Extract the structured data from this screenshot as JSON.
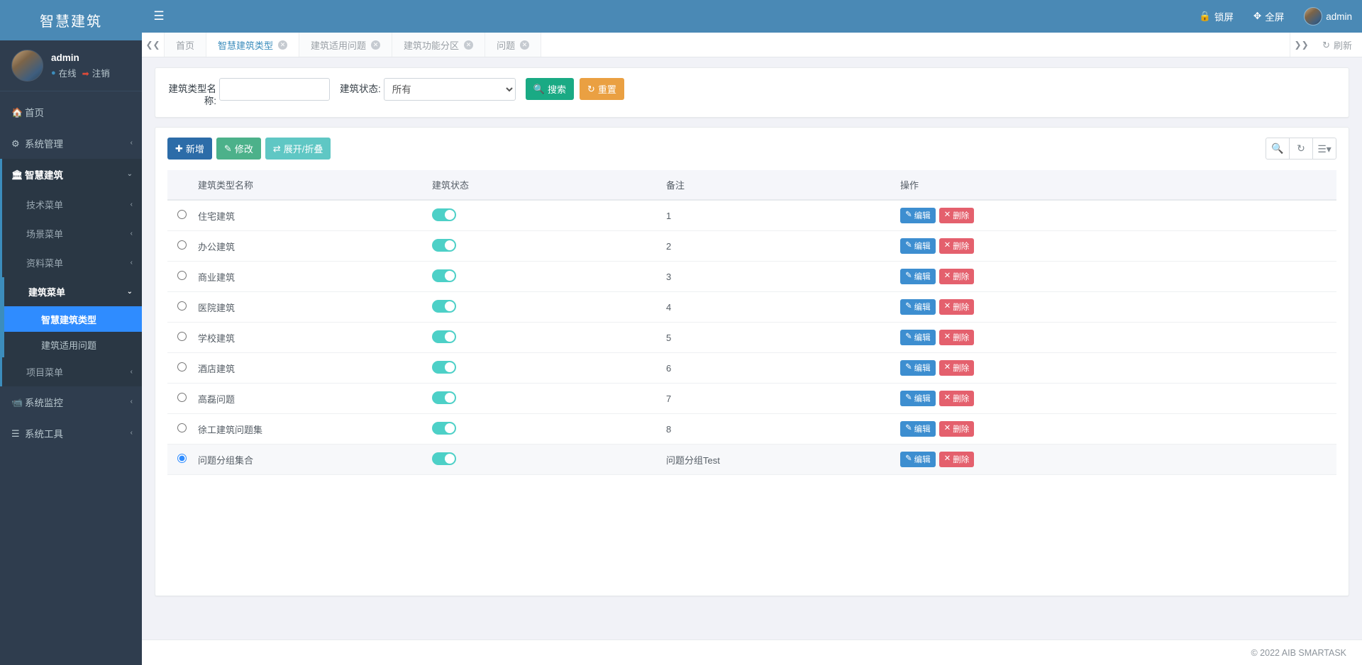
{
  "brand": {
    "title": "智慧建筑"
  },
  "user_panel": {
    "name": "admin",
    "status": "在线",
    "logout": "注销",
    "avatar_icon": "user-avatar",
    "status_dot_icon": "circle-icon",
    "logout_icon": "sign-out-icon"
  },
  "navbar": {
    "hamburger_icon": "hamburger-icon",
    "lock_label": "锁屏",
    "lock_icon": "lock-icon",
    "fullscreen_label": "全屏",
    "fullscreen_icon": "expand-icon",
    "user_label": "admin",
    "user_avatar_icon": "user-avatar"
  },
  "sidebar": {
    "items": [
      {
        "label": "首页",
        "icon": "home-icon",
        "caret": "",
        "active": false
      },
      {
        "label": "系统管理",
        "icon": "gear-icon",
        "caret": "‹",
        "active": false
      },
      {
        "label": "智慧建筑",
        "icon": "bank-icon",
        "caret": "⌄",
        "active": true
      },
      {
        "label": "系统监控",
        "icon": "video-icon",
        "caret": "‹",
        "active": false
      },
      {
        "label": "系统工具",
        "icon": "list-icon",
        "caret": "‹",
        "active": false
      }
    ],
    "submenu": [
      {
        "label": "技术菜单",
        "caret": "‹",
        "open": false
      },
      {
        "label": "场景菜单",
        "caret": "‹",
        "open": false
      },
      {
        "label": "资料菜单",
        "caret": "‹",
        "open": false
      },
      {
        "label": "建筑菜单",
        "caret": "⌄",
        "open": true
      },
      {
        "label": "项目菜单",
        "caret": "‹",
        "open": false
      }
    ],
    "building_submenu": [
      {
        "label": "智慧建筑类型",
        "active": true
      },
      {
        "label": "建筑适用问题",
        "active": false
      }
    ]
  },
  "tabbar": {
    "left_arrow_icon": "chevron-double-left-icon",
    "right_arrow_icon": "chevron-double-right-icon",
    "refresh_label": "刷新",
    "refresh_icon": "refresh-icon",
    "tabs": [
      {
        "label": "首页",
        "active": false,
        "closable": false
      },
      {
        "label": "智慧建筑类型",
        "active": true,
        "closable": true
      },
      {
        "label": "建筑适用问题",
        "active": false,
        "closable": true
      },
      {
        "label": "建筑功能分区",
        "active": false,
        "closable": true
      },
      {
        "label": "问题",
        "active": false,
        "closable": true
      }
    ]
  },
  "search": {
    "name_label": "建筑类型名称:",
    "name_value": "",
    "name_placeholder": "",
    "status_label": "建筑状态:",
    "status_value": "所有",
    "status_options": [
      "所有"
    ],
    "search_label": "搜索",
    "search_icon": "search-icon",
    "reset_label": "重置",
    "reset_icon": "refresh-icon"
  },
  "toolbar": {
    "add_label": "新增",
    "add_icon": "plus-icon",
    "edit_label": "修改",
    "edit_icon": "pencil-square-icon",
    "expand_label": "展开/折叠",
    "expand_icon": "exchange-icon",
    "search_icon": "search-icon",
    "refresh_icon": "refresh-icon",
    "columns_icon": "list-columns-icon",
    "columns_caret": "▾"
  },
  "table": {
    "columns": [
      "建筑类型名称",
      "建筑状态",
      "备注",
      "操作"
    ],
    "edit_label": "编辑",
    "edit_icon": "pencil-square-icon",
    "delete_label": "删除",
    "delete_icon": "times-icon",
    "rows": [
      {
        "name": "住宅建筑",
        "status_on": true,
        "remark": "1",
        "selected": false
      },
      {
        "name": "办公建筑",
        "status_on": true,
        "remark": "2",
        "selected": false
      },
      {
        "name": "商业建筑",
        "status_on": true,
        "remark": "3",
        "selected": false
      },
      {
        "name": "医院建筑",
        "status_on": true,
        "remark": "4",
        "selected": false
      },
      {
        "name": "学校建筑",
        "status_on": true,
        "remark": "5",
        "selected": false
      },
      {
        "name": "酒店建筑",
        "status_on": true,
        "remark": "6",
        "selected": false
      },
      {
        "name": "高磊问题",
        "status_on": true,
        "remark": "7",
        "selected": false
      },
      {
        "name": "徐工建筑问题集",
        "status_on": true,
        "remark": "8",
        "selected": false
      },
      {
        "name": "问题分组集合",
        "status_on": true,
        "remark": "问题分组Test",
        "selected": true
      }
    ]
  },
  "footer": {
    "copyright": "© 2022 AIB SMARTASK"
  },
  "colors": {
    "header_blue": "#4a89b5",
    "sidebar_dark": "#2f3d4e",
    "active_blue": "#2f8cff",
    "switch_teal": "#4dd0c7",
    "btn_search_green": "#1aaa84",
    "btn_reset_orange": "#eaa042",
    "btn_add_blue": "#2c6ca8",
    "btn_delete_red": "#e4606d"
  }
}
